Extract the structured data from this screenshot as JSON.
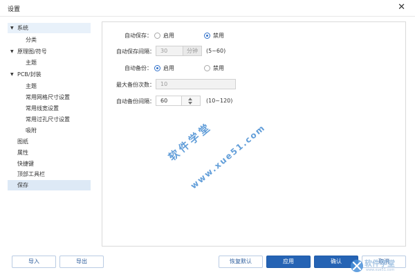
{
  "window": {
    "title": "设置",
    "close_glyph": "✕"
  },
  "sidebar": {
    "items": [
      {
        "label": "系统",
        "expandable": true
      },
      {
        "label": "分类"
      },
      {
        "label": "原理图/符号",
        "expandable": true
      },
      {
        "label": "主题"
      },
      {
        "label": "PCB/封装",
        "expandable": true
      },
      {
        "label": "主题"
      },
      {
        "label": "常用网格尺寸设置"
      },
      {
        "label": "常用线宽设置"
      },
      {
        "label": "常用过孔尺寸设置"
      },
      {
        "label": "吸附"
      },
      {
        "label": "图纸"
      },
      {
        "label": "属性"
      },
      {
        "label": "快捷键"
      },
      {
        "label": "顶部工具栏"
      },
      {
        "label": "保存",
        "selected": true
      }
    ]
  },
  "form": {
    "autosave": {
      "label": "自动保存：",
      "options": [
        "启用",
        "禁用"
      ],
      "selected": "禁用"
    },
    "autosave_interval": {
      "label": "自动保存间隔：",
      "value": "30",
      "unit": "分钟",
      "range": "(5~60)"
    },
    "autobackup": {
      "label": "自动备份：",
      "options": [
        "启用",
        "禁用"
      ],
      "selected": "启用"
    },
    "max_backups": {
      "label": "最大备份次数：",
      "value": "10"
    },
    "backup_interval": {
      "label": "自动备份间隔：",
      "value": "60",
      "range": "(10~120)"
    }
  },
  "buttons": {
    "import": "导入",
    "export": "导出",
    "restore_defaults": "恢复默认",
    "apply": "应用",
    "ok": "确认",
    "cancel": "取消"
  },
  "watermark": {
    "line1": "软件学堂",
    "line2": "www.xue51.com"
  },
  "logo": {
    "text": "软件学堂",
    "subtext": "www.xue51.com"
  },
  "colors": {
    "accent": "#2563b4",
    "selected_bg": "#dde9f6",
    "watermark": "#3b86d0"
  }
}
